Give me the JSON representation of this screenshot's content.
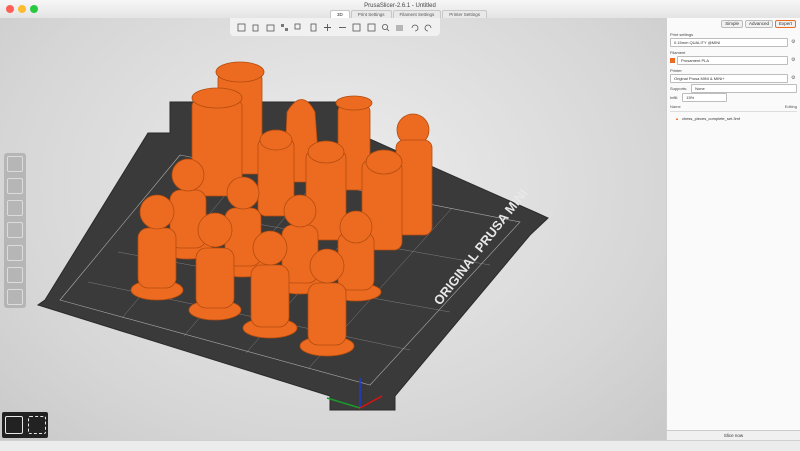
{
  "window": {
    "title": "PrusaSlicer-2.6.1 - Untitled",
    "tabs": [
      "3D",
      "Print Settings",
      "Filament Settings",
      "Printer Settings"
    ],
    "active_tab": 0
  },
  "viewport": {
    "bed_label": "ORIGINAL PRUSA MINI",
    "object_color": "#ed6b21",
    "bed_color": "#333333"
  },
  "sidebar": {
    "modes": [
      "Simple",
      "Advanced",
      "Expert"
    ],
    "print_settings_label": "Print settings",
    "print_profile": "0.15mm QUALITY @MINI",
    "filament_label": "Filament",
    "filament_profile": "Prusament PLA",
    "printer_label": "Printer",
    "printer_profile": "Original Prusa MINI & MINI+",
    "supports_label": "Supports:",
    "supports_value": "None",
    "infill_label": "Infill:",
    "infill_value": "15%",
    "list_name_header": "Name",
    "list_editing_header": "Editing",
    "object_name": "chess_pieces_complete_set.3mf",
    "slice_button": "Slice now"
  },
  "colors": {
    "accent": "#ed6b21",
    "toolbar_bg": "#f5f5f5"
  }
}
